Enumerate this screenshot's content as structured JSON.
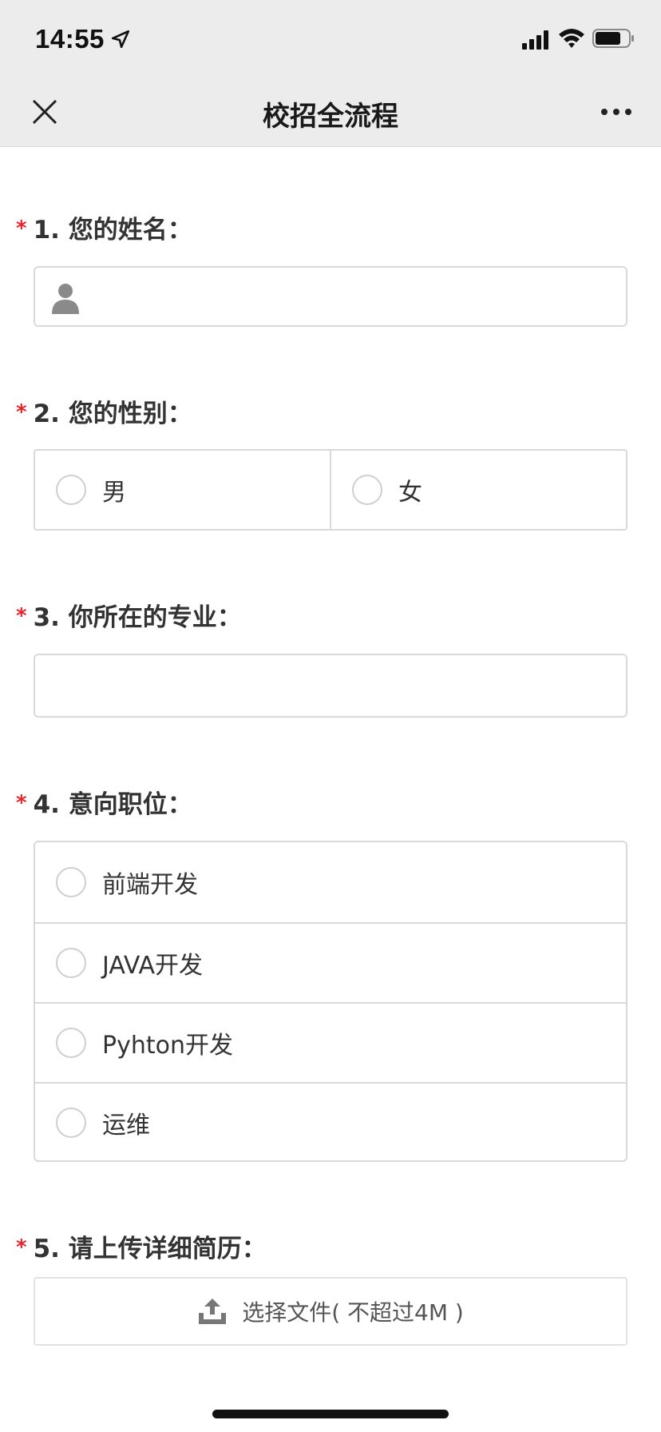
{
  "status_bar": {
    "time": "14:55"
  },
  "nav": {
    "title": "校招全流程"
  },
  "form": {
    "required_mark": "*",
    "q1": {
      "label": "1. 您的姓名：",
      "value": "",
      "placeholder": ""
    },
    "q2": {
      "label": "2. 您的性别：",
      "options": [
        "男",
        "女"
      ]
    },
    "q3": {
      "label": "3. 你所在的专业：",
      "value": "",
      "placeholder": ""
    },
    "q4": {
      "label": "4. 意向职位：",
      "options": [
        "前端开发",
        "JAVA开发",
        "Pyhton开发",
        "运维"
      ]
    },
    "q5": {
      "label": "5. 请上传详细简历：",
      "upload_label": "选择文件( 不超过4M )"
    }
  },
  "colors": {
    "required": "#e5242b",
    "border": "#d9d9d9",
    "bar_background": "#ececec"
  },
  "icons": [
    "location-arrow-icon",
    "signal-icon",
    "wifi-icon",
    "battery-icon",
    "close-icon",
    "more-icon",
    "person-icon",
    "upload-icon"
  ]
}
